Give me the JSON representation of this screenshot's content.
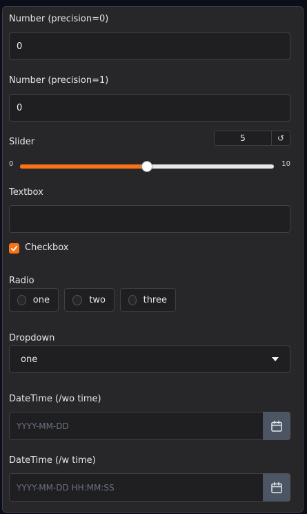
{
  "number0": {
    "label": "Number (precision=0)",
    "value": "0"
  },
  "number1": {
    "label": "Number (precision=1)",
    "value": "0"
  },
  "slider": {
    "label": "Slider",
    "min": "0",
    "max": "10",
    "value": "5",
    "fraction": 0.5,
    "reset_icon": "↺"
  },
  "textbox": {
    "label": "Textbox",
    "value": ""
  },
  "checkbox": {
    "label": "Checkbox",
    "checked": true
  },
  "radio": {
    "label": "Radio",
    "options": [
      "one",
      "two",
      "three"
    ]
  },
  "dropdown": {
    "label": "Dropdown",
    "selected": "one"
  },
  "date_notime": {
    "label": "DateTime (/wo time)",
    "placeholder": "YYYY-MM-DD"
  },
  "date_time": {
    "label": "DateTime (/w time)",
    "placeholder": "YYYY-MM-DD HH:MM:SS"
  },
  "colors": {
    "accent": "#f97316",
    "panel": "#27272a",
    "field": "#1f1f22"
  },
  "icons": [
    "reset-icon",
    "check-icon",
    "chevron-down-icon",
    "calendar-icon"
  ]
}
